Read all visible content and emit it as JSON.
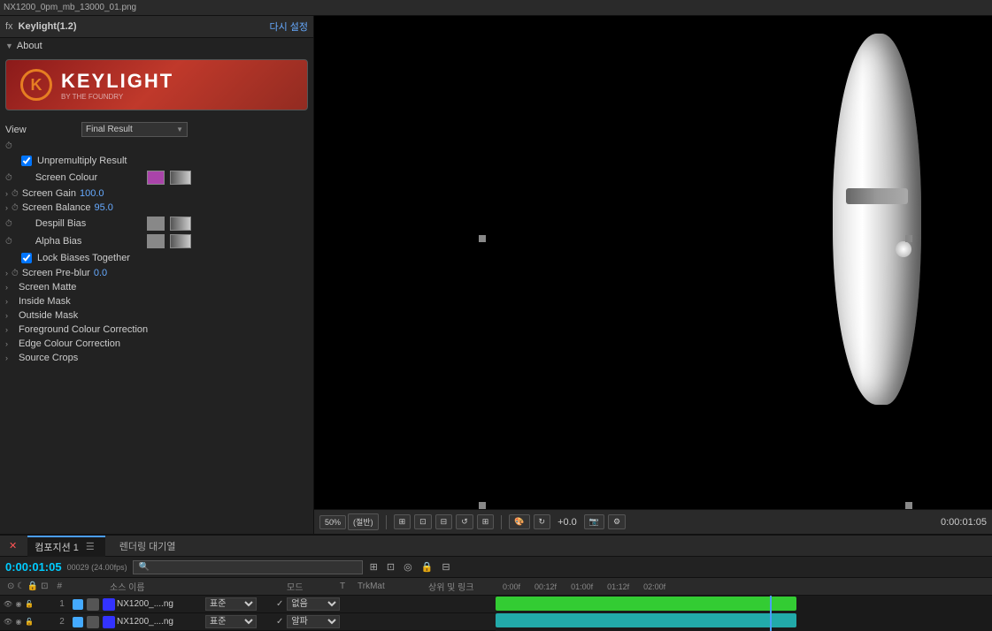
{
  "topbar": {
    "filename": "NX1200_0pm_mb_13000_01.png"
  },
  "fx_panel": {
    "fx_label": "fx",
    "keylight_version": "Keylight(1.2)",
    "reset_label": "다시 설정",
    "about_section": "About",
    "logo_k": "K",
    "logo_text": "KEYLIGHT",
    "logo_sub": "BY THE FOUNDRY",
    "view_label": "View",
    "view_value": "Final Result",
    "unpremultiply": "Unpremultiply Result",
    "screen_colour_label": "Screen Colour",
    "screen_gain_label": "Screen Gain",
    "screen_gain_value": "100.0",
    "screen_balance_label": "Screen Balance",
    "screen_balance_value": "95.0",
    "despill_bias_label": "Despill Bias",
    "alpha_bias_label": "Alpha Bias",
    "lock_biases_label": "Lock Biases Together",
    "screen_preblur_label": "Screen Pre-blur",
    "screen_preblur_value": "0.0",
    "screen_matte_label": "Screen Matte",
    "inside_mask_label": "Inside Mask",
    "outside_mask_label": "Outside Mask",
    "fg_colour_label": "Foreground Colour Correction",
    "edge_colour_label": "Edge Colour Correction",
    "source_crops_label": "Source Crops"
  },
  "preview": {
    "zoom_value": "50%",
    "zoom_label": "50%",
    "fit_label": "(절반)",
    "time_display": "0:00:01:05"
  },
  "timeline": {
    "comp_tab": "컴포지션 1",
    "render_queue": "렌더링 대기열",
    "timecode": "0:00:01:05",
    "fps": "00029 (24.00fps)",
    "columns": {
      "source": "소스 이름",
      "mode": "모드",
      "t": "T",
      "trkmat": "TrkMat",
      "parent": "상위 및 링크"
    },
    "ruler": {
      "marks": [
        "0:00f",
        "00:12f",
        "01:00f",
        "01:12f",
        "02:00f"
      ]
    },
    "layers": [
      {
        "number": "1",
        "color": "#4af",
        "name": "NX1200_....ng",
        "mode": "표준",
        "trkmat": "",
        "alpha_mode": "없음",
        "track_color": "#33cc33",
        "track_x": 0,
        "track_w": 340
      },
      {
        "number": "2",
        "color": "#4af",
        "name": "NX1200_....ng",
        "mode": "표준",
        "trkmat": "",
        "alpha_mode": "알파",
        "track_color": "#22aaaa",
        "track_x": 0,
        "track_w": 340
      }
    ]
  }
}
